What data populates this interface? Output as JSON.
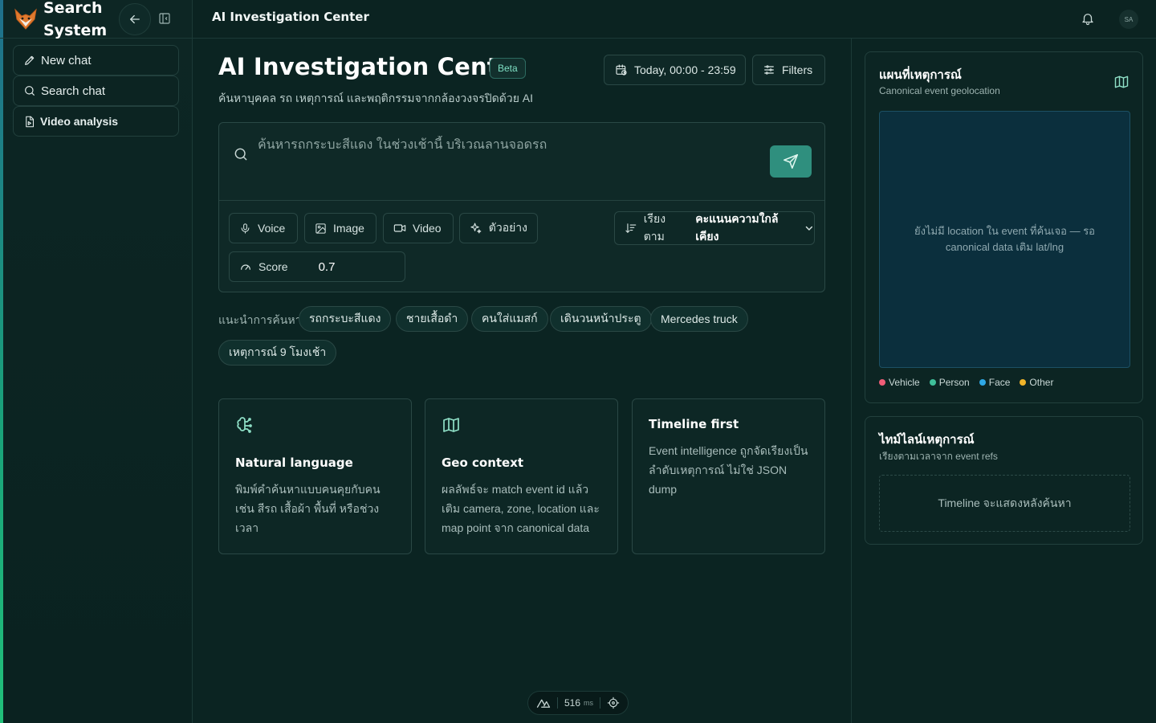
{
  "app": {
    "brand_line1": "Search",
    "brand_line2": "System",
    "accent_color": "#2f8f7e"
  },
  "sidebar": {
    "items": [
      {
        "label": "New chat",
        "icon": "pencil-icon"
      },
      {
        "label": "Search chat",
        "icon": "search-icon"
      },
      {
        "label": "Video analysis",
        "icon": "file-video-icon"
      }
    ]
  },
  "topbar": {
    "title": "AI Investigation Center",
    "avatar_initials": "SA"
  },
  "main": {
    "title": "AI Investigation Center",
    "badge": "Beta",
    "subtitle": "ค้นหาบุคคล รถ เหตุการณ์ และพฤติกรรมจากกล้องวงจรปิดด้วย AI",
    "date_range": "Today, 00:00 - 23:59",
    "filters_label": "Filters",
    "search": {
      "placeholder": "ค้นหารถกระบะสีแดง ในช่วงเช้านี้ บริเวณลานจอดรถ",
      "value": ""
    },
    "tools": {
      "voice": "Voice",
      "image": "Image",
      "video": "Video",
      "example": "ตัวอย่าง"
    },
    "sort": {
      "label": "เรียงตาม",
      "value": "คะแนนความใกล้เคียง"
    },
    "score": {
      "label": "Score",
      "value": "0.7"
    },
    "suggestions": {
      "label": "แนะนำการค้นหา",
      "chips": [
        "รถกระบะสีแดง",
        "ชายเสื้อดำ",
        "คนใส่แมสก์",
        "เดินวนหน้าประตู",
        "Mercedes truck",
        "เหตุการณ์ 9 โมงเช้า"
      ]
    },
    "cards": [
      {
        "icon": "brain-icon",
        "title": "Natural language",
        "desc": "พิมพ์คำค้นหาแบบคนคุยกับคน เช่น สีรถ เสื้อผ้า พื้นที่ หรือช่วงเวลา"
      },
      {
        "icon": "map-icon",
        "title": "Geo context",
        "desc": "ผลลัพธ์จะ match event id แล้วเติม camera, zone, location และ map point จาก canonical data"
      },
      {
        "icon": "",
        "title": "Timeline first",
        "desc": "Event intelligence ถูกจัดเรียงเป็นลำดับเหตุการณ์ ไม่ใช่ JSON dump"
      }
    ],
    "perf": {
      "value": "516",
      "unit": "ms"
    }
  },
  "right": {
    "map": {
      "title": "แผนที่เหตุการณ์",
      "subtitle": "Canonical event geolocation",
      "empty": "ยังไม่มี location ใน event ที่ค้นเจอ — รอ canonical data เติม lat/lng",
      "legend": [
        {
          "label": "Vehicle",
          "color": "#f05d77"
        },
        {
          "label": "Person",
          "color": "#3fbf9a"
        },
        {
          "label": "Face",
          "color": "#2ea8e6"
        },
        {
          "label": "Other",
          "color": "#f0b429"
        }
      ]
    },
    "timeline": {
      "title": "ไทม์ไลน์เหตุการณ์",
      "subtitle": "เรียงตามเวลาจาก event refs",
      "empty": "Timeline จะแสดงหลังค้นหา"
    }
  }
}
